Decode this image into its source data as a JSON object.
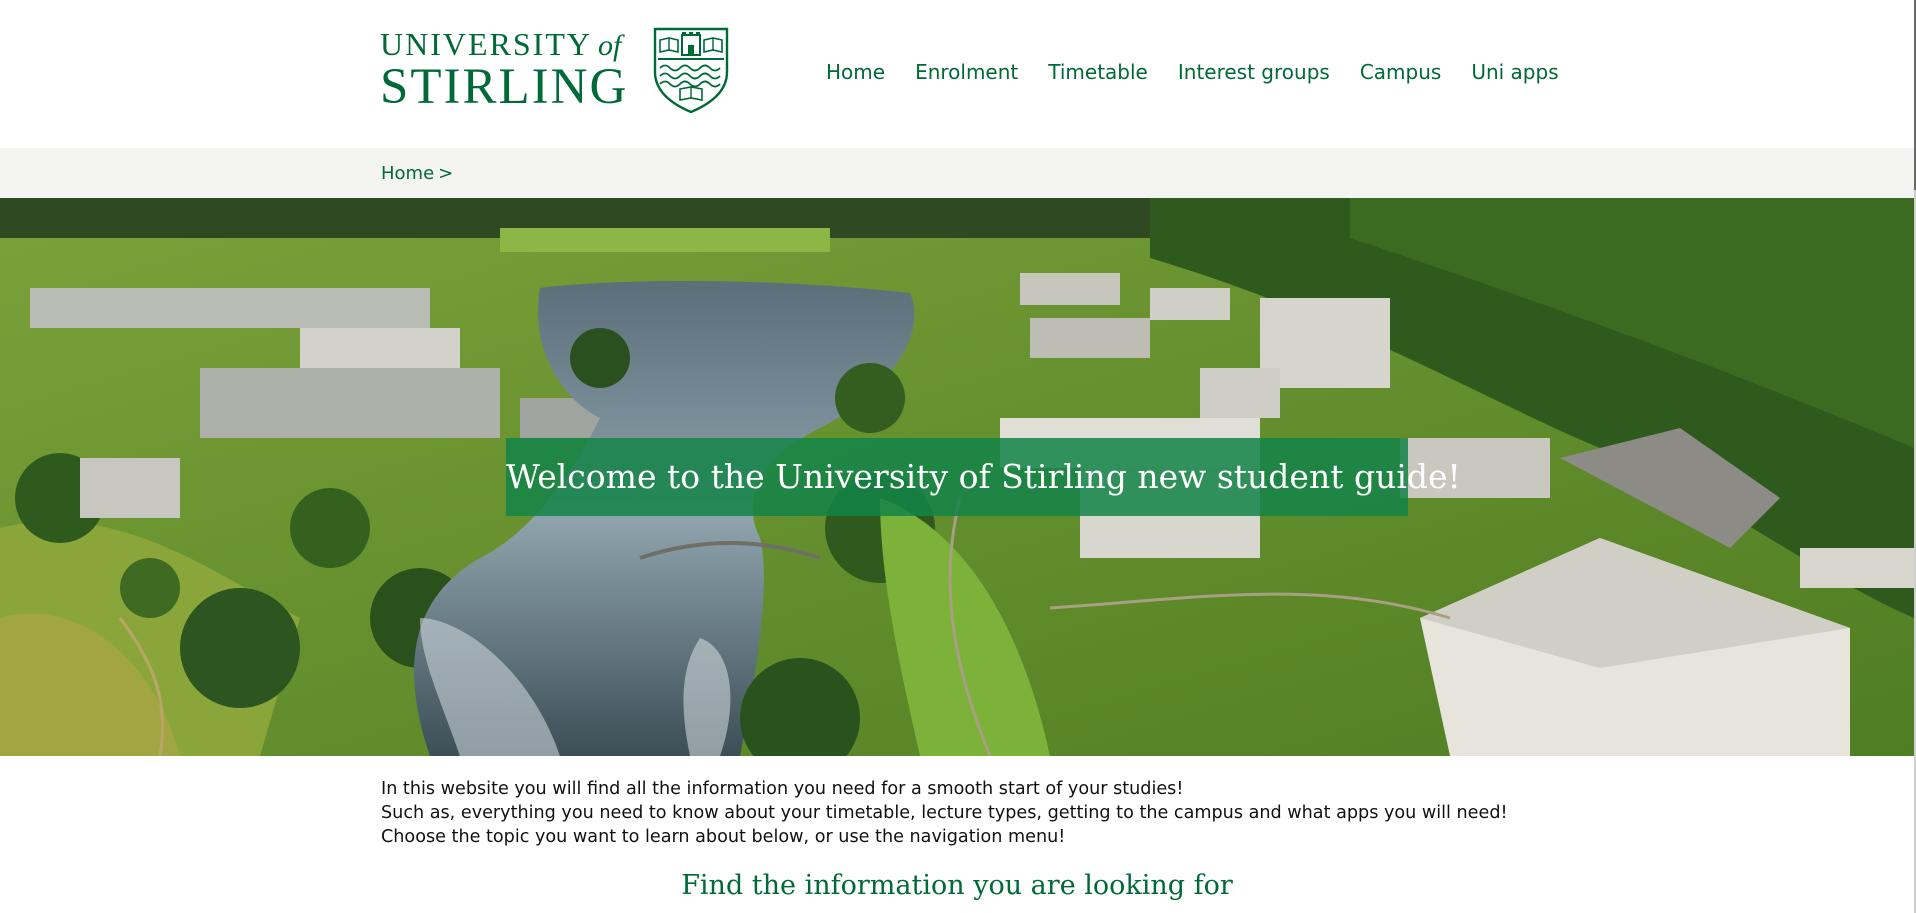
{
  "header": {
    "logo": {
      "line1": "UNIVERSITY",
      "line1_of": "of",
      "line2": "STIRLING"
    },
    "nav": [
      {
        "label": "Home"
      },
      {
        "label": "Enrolment"
      },
      {
        "label": "Timetable"
      },
      {
        "label": "Interest groups"
      },
      {
        "label": "Campus"
      },
      {
        "label": "Uni apps"
      }
    ]
  },
  "breadcrumb": {
    "home": "Home",
    "separator": ">"
  },
  "hero": {
    "image_subject": "aerial-campus-photo",
    "title": "Welcome to the University of Stirling new student guide!"
  },
  "intro": {
    "lines": [
      "In this website you will find all the information you need for a smooth start of your studies!",
      "Such as, everything you need to know about your timetable, lecture types, getting to the campus and what apps you will need!",
      "Choose the topic you want to learn about below, or use the navigation menu!"
    ]
  },
  "section": {
    "heading": "Find the information you are looking for"
  },
  "colors": {
    "brand_green": "#006938",
    "banner_green": "#148448",
    "breadcrumb_bg": "#f3f3f1"
  }
}
